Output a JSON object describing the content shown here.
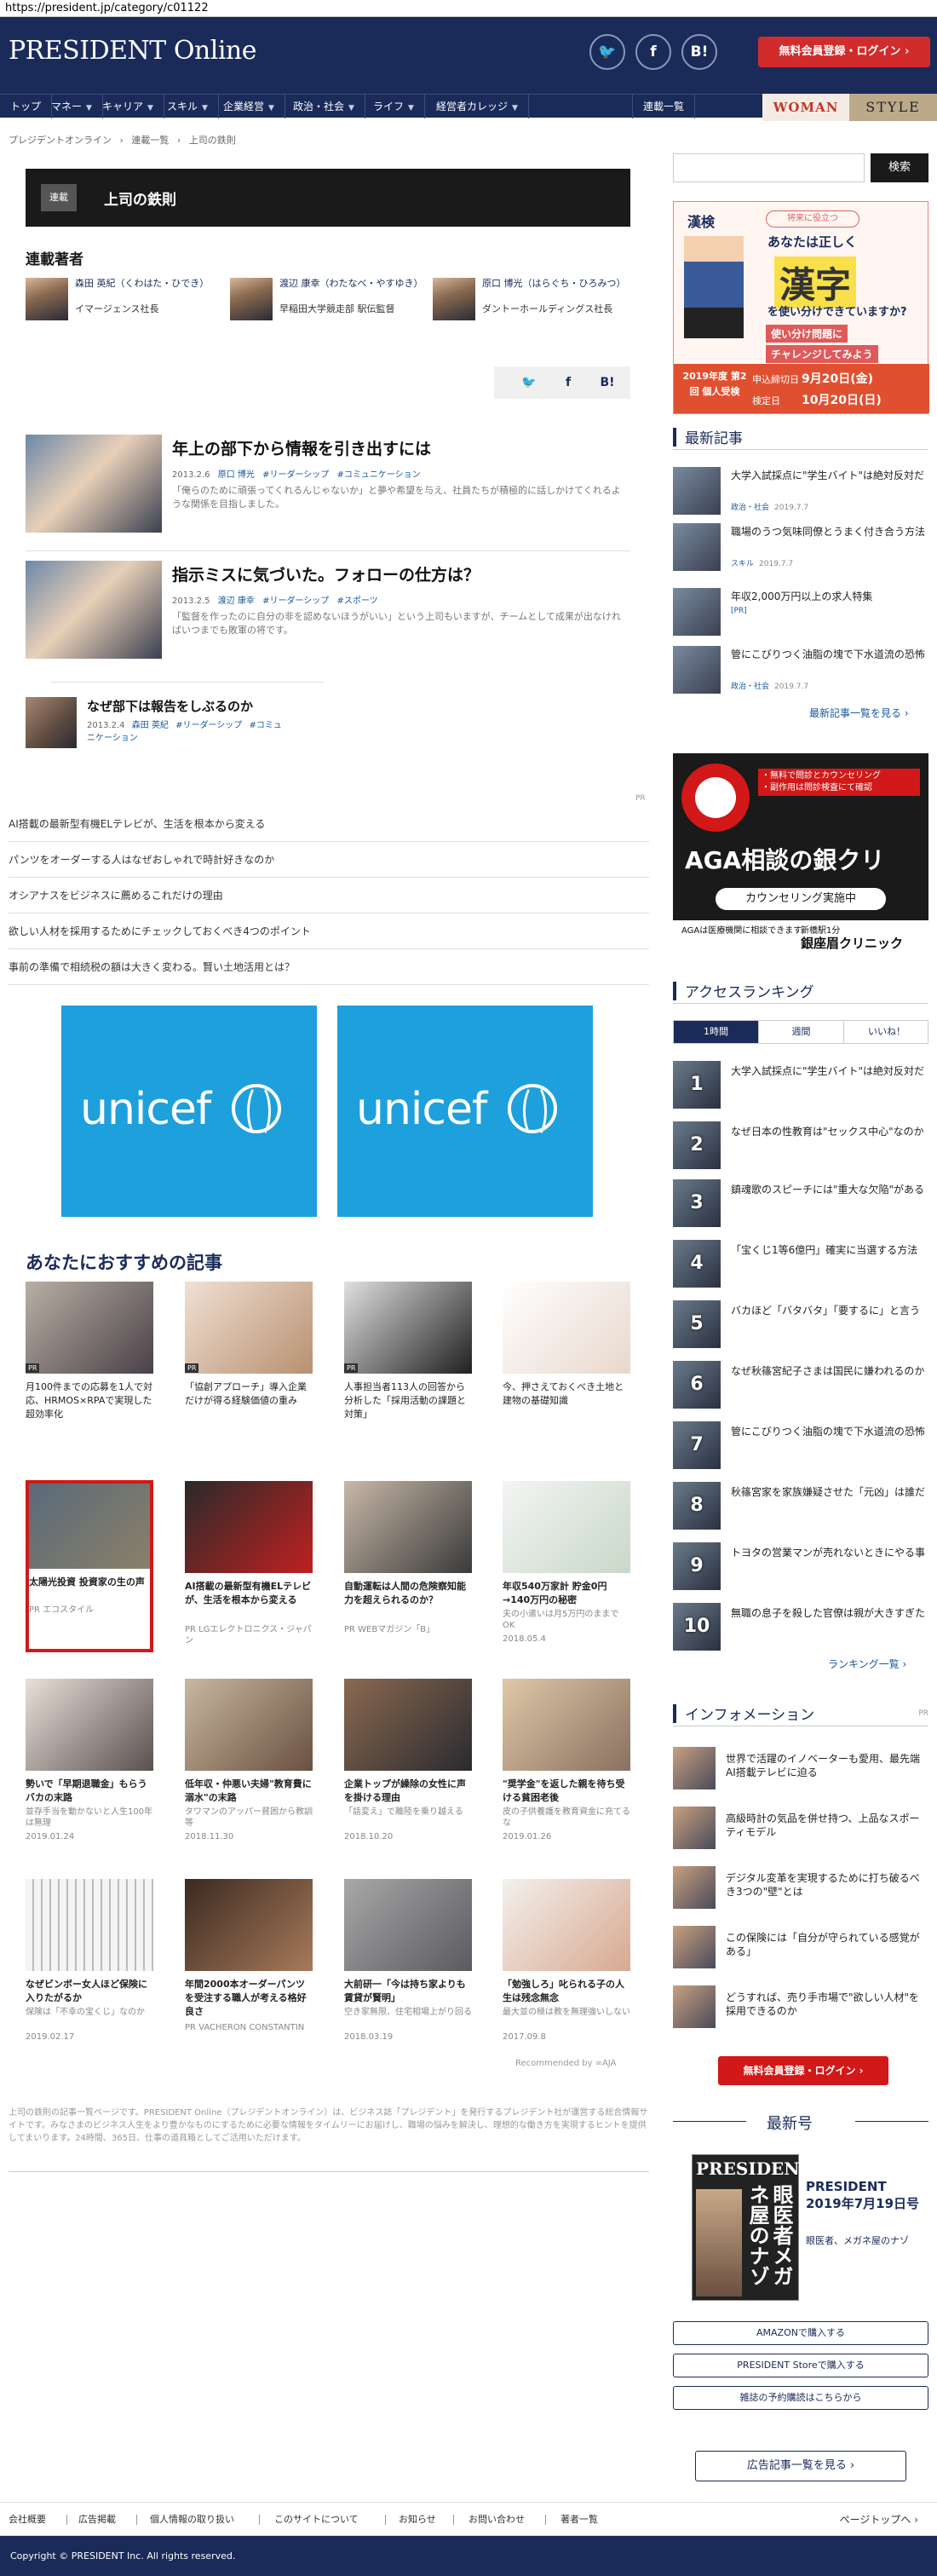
{
  "url": "https://president.jp/category/c01122",
  "header": {
    "logo": "PRESIDENT Online",
    "sns": [
      "twitter",
      "facebook",
      "B!"
    ],
    "login": "無料会員登録・ログイン ›"
  },
  "nav": {
    "items": [
      {
        "label": "トップ",
        "caret": ""
      },
      {
        "label": "マネー",
        "caret": "▼"
      },
      {
        "label": "キャリア",
        "caret": "▼"
      },
      {
        "label": "スキル",
        "caret": "▼"
      },
      {
        "label": "企業経営",
        "caret": "▼"
      },
      {
        "label": "政治・社会",
        "caret": "▼"
      },
      {
        "label": "ライフ",
        "caret": "▼"
      },
      {
        "label": "経営者カレッジ",
        "caret": "▼"
      },
      {
        "label": "連載一覧",
        "caret": ""
      }
    ],
    "woman": "WOMAN",
    "style": "STYLE"
  },
  "breadcrumb": [
    "プレジデントオンライン",
    "›",
    "連載一覧",
    "›",
    "上司の鉄則"
  ],
  "section": {
    "tag": "連載",
    "title": "上司の鉄則"
  },
  "authors": {
    "heading": "連載著者",
    "list": [
      {
        "name": "森田 英紀（くわはた・ひでき）",
        "affil": "イマージェンス社長"
      },
      {
        "name": "渡辺 康幸（わたなべ・やすゆき）",
        "affil": "早稲田大学競走部 駅伝監督"
      },
      {
        "name": "原口 博光（はらぐち・ひろみつ）",
        "affil": "ダントーホールディングス社長"
      }
    ]
  },
  "share": [
    "twitter",
    "f",
    "B!"
  ],
  "articles": [
    {
      "title": "年上の部下から情報を引き出すには",
      "date": "2013.2.6",
      "author": "原口 博光",
      "tags": [
        "#リーダーシップ",
        "#コミュニケーション"
      ],
      "desc": "「俺らのために頑張ってくれるんじゃないか」と夢や希望を与え、社員たちが積極的に話しかけてくれるような関係を目指しました。"
    },
    {
      "title": "指示ミスに気づいた。フォローの仕方は？",
      "date": "2013.2.5",
      "author": "渡辺 康幸",
      "tags": [
        "#リーダーシップ",
        "#スポーツ"
      ],
      "desc": "「監督を作ったのに自分の非を認めないほうがいい」という上司もいますが、チームとして成果が出なければいつまでも敗軍の将です。"
    }
  ],
  "article3": {
    "title": "なぜ部下は報告をしぶるのか",
    "date": "2013.2.4",
    "author": "森田 英紀",
    "tags": [
      "#リーダーシップ",
      "#コミュニケーション"
    ]
  },
  "pr": {
    "label": "PR",
    "links": [
      "AI搭載の最新型有機ELテレビが、生活を根本から変える",
      "パンツをオーダーする人はなぜおしゃれで時計好きなのか",
      "オシアナスをビジネスに薦めるこれだけの理由",
      "欲しい人材を採用するためにチェックしておくべき4つのポイント",
      "事前の準備で相続税の額は大きく変わる。賢い土地活用とは？"
    ]
  },
  "unicef": "unicef",
  "recommend": {
    "heading": "あなたにおすすめの記事",
    "items": [
      {
        "title": "月100件までの応募を1人で対応、HRMOS×RPAで実現した超効率化",
        "sub": "",
        "date": "",
        "pr": true
      },
      {
        "title": "「協創アプローチ」導入企業だけが得る経験価値の重み",
        "sub": "",
        "date": "",
        "pr": true
      },
      {
        "title": "人事担当者113人の回答から分析した「採用活動の課題と対策」",
        "sub": "",
        "date": "",
        "pr": true
      },
      {
        "title": "今、押さえておくべき土地と建物の基礎知識",
        "sub": "",
        "date": "",
        "pr": false
      },
      {
        "title": "太陽光投資 投資家の生の声",
        "sub": "PR エコスタイル",
        "date": "",
        "pr": false
      },
      {
        "title": "AI搭載の最新型有機ELテレビが、生活を根本から変える",
        "sub": "PR LGエレクトロニクス・ジャパン",
        "date": "",
        "pr": false
      },
      {
        "title": "自動運転は人間の危険察知能力を超えられるのか？",
        "sub": "PR WEBマガジン「B」",
        "date": "",
        "pr": false
      },
      {
        "title": "年収540万家計 貯金0円→140万円の秘密",
        "sub": "夫の小遣いは月5万円のままでOK",
        "date": "2018.05.4",
        "pr": false
      },
      {
        "title": "勢いで「早期退職金」もらうバカの末路",
        "sub": "並存手当を動かないと人生100年は無理",
        "date": "2019.01.24",
        "pr": false
      },
      {
        "title": "低年収・仲悪い夫婦\"教育費に溺水\"の末路",
        "sub": "タワマンのアッパー貧困から教訓等",
        "date": "2018.11.30",
        "pr": false
      },
      {
        "title": "企業トップが繰除の女性に声を掛ける理由",
        "sub": "「話変え」で離陸を乗り越える",
        "date": "2018.10.20",
        "pr": false
      },
      {
        "title": "\"奨学金\"を返した親を待ち受ける貧困老後",
        "sub": "皮の子供養護を教育資金に充てるな",
        "date": "2019.01.26",
        "pr": false
      },
      {
        "title": "なぜビンボー女人ほど保険に入りたがるか",
        "sub": "保険は「不幸の宝くじ」なのか",
        "date": "2019.02.17",
        "pr": false
      },
      {
        "title": "年間2000本オーダーパンツを受注する職人が考える格好良さ",
        "sub": "PR VACHERON CONSTANTIN",
        "date": "",
        "pr": false
      },
      {
        "title": "大前研一「今は持ち家よりも賃貸が賢明」",
        "sub": "空き家無限、住宅相場上がり回る",
        "date": "2018.03.19",
        "pr": false
      },
      {
        "title": "「勉強しろ」叱られる子の人生は残念無念",
        "sub": "最大並の極は教を無理強いしない",
        "date": "2017.09.8",
        "pr": false
      }
    ],
    "recommended_by": "Recommended by ∞AJA"
  },
  "description": "上司の鉄則の記事一覧ページです。PRESIDENT Online（プレジデントオンライン）は、ビジネス誌「プレジデント」を発行するプレジデント社が運営する総合情報サイトです。みなさまのビジネス人生をより豊かなものにするために必要な情報をタイムリーにお届けし、職場の悩みを解決し、理想的な働き方を実現するヒントを提供してまいります。24時間、365日、仕事の道具箱としてご活用いただけます。",
  "sidebar": {
    "search_placeholder": "",
    "search_btn": "検索",
    "kanji_ad": {
      "top": "漢検",
      "pill": "将来に役立つ",
      "t1": "あなたは正しく",
      "big": "漢字",
      "t2": "を使い分けできていますか?",
      "t3": "使い分け問題に",
      "t4": "チャレンジしてみよう",
      "yr": "2019年度 第2回 個人受検",
      "dl1": "申込締切日",
      "dt1": "9月20日(金)",
      "dl2": "検定日",
      "dt2": "10月20日(日)"
    },
    "latest": {
      "heading": "最新記事",
      "items": [
        {
          "title": "大学入試採点に\"学生バイト\"は絶対反対だ",
          "cat": "政治・社会",
          "date": "2019.7.7"
        },
        {
          "title": "職場のうつ気味同僚とうまく付き合う方法",
          "cat": "スキル",
          "date": "2019.7.7"
        },
        {
          "title": "年収2,000万円以上の求人特集",
          "cat": "[PR]",
          "date": ""
        },
        {
          "title": "管にこびりつく油脂の塊で下水道流の恐怖",
          "cat": "政治・社会",
          "date": "2019.7.7"
        }
      ],
      "more": "最新記事一覧を見る ›"
    },
    "aga": {
      "b1": "・無料で問診とカウンセリング",
      "b2": "・副作用は問診検査にて確認",
      "main": "AGA相談の銀クリ",
      "pill": "カウンセリング実施中",
      "foot": "AGAは医療機関に相談できます。",
      "r1": "新橋駅1分",
      "r2": "銀座眉クリニック"
    },
    "ranking": {
      "heading": "アクセスランキング",
      "tabs": [
        "1時間",
        "週間",
        "いいね！"
      ],
      "items": [
        "大学入試採点に\"学生バイト\"は絶対反対だ",
        "なぜ日本の性教育は\"セックス中心\"なのか",
        "鎮魂歌のスピーチには\"重大な欠陥\"がある",
        "「宝くじ1等6億円」確実に当選する方法",
        "バカほど「バタバタ」「要するに」と言う",
        "なぜ秋篠宮紀子さまは国民に嫌われるのか",
        "管にこびりつく油脂の塊で下水道流の恐怖",
        "秋篠宮家を家族嫌疑させた「元凶」は誰だ",
        "トヨタの営業マンが売れないときにやる事",
        "無職の息子を殺した官僚は親が大きすぎた"
      ],
      "more": "ランキング一覧 ›"
    },
    "info": {
      "heading": "インフォメーション",
      "pr": "PR",
      "items": [
        "世界で活躍のイノベーターも愛用、最先端AI搭載テレビに迫る",
        "高級時計の気品を併せ持つ、上品なスポーティモデル",
        "デジタル変革を実現するために打ち破るべき3つの\"壁\"とは",
        "この保険には「自分が守られている感覚がある」",
        "どうすれば、売り手市場で\"欲しい人材\"を採用できるのか"
      ]
    },
    "login": "無料会員登録・ログイン ›",
    "newissue": "最新号",
    "mag_title": "PRESIDENT",
    "mag_kanji": "眼医者メガネ屋のナゾ",
    "issue_title": "PRESIDENT 2019年7月19日号",
    "issue_sub": "眼医者、メガネ屋のナゾ",
    "buy": [
      "AMAZONで購入する",
      "PRESIDENT Storeで購入する",
      "雑誌の予約購読はこちらから"
    ],
    "adlist": "広告記事一覧を見る ›"
  },
  "footer": {
    "links": [
      "会社概要",
      "広告掲載",
      "個人情報の取り扱い",
      "このサイトについて",
      "お知らせ",
      "お問い合わせ",
      "著者一覧"
    ],
    "pagetop": "ページトップへ ›",
    "copyright": "Copyright © PRESIDENT Inc. All rights reserved."
  }
}
